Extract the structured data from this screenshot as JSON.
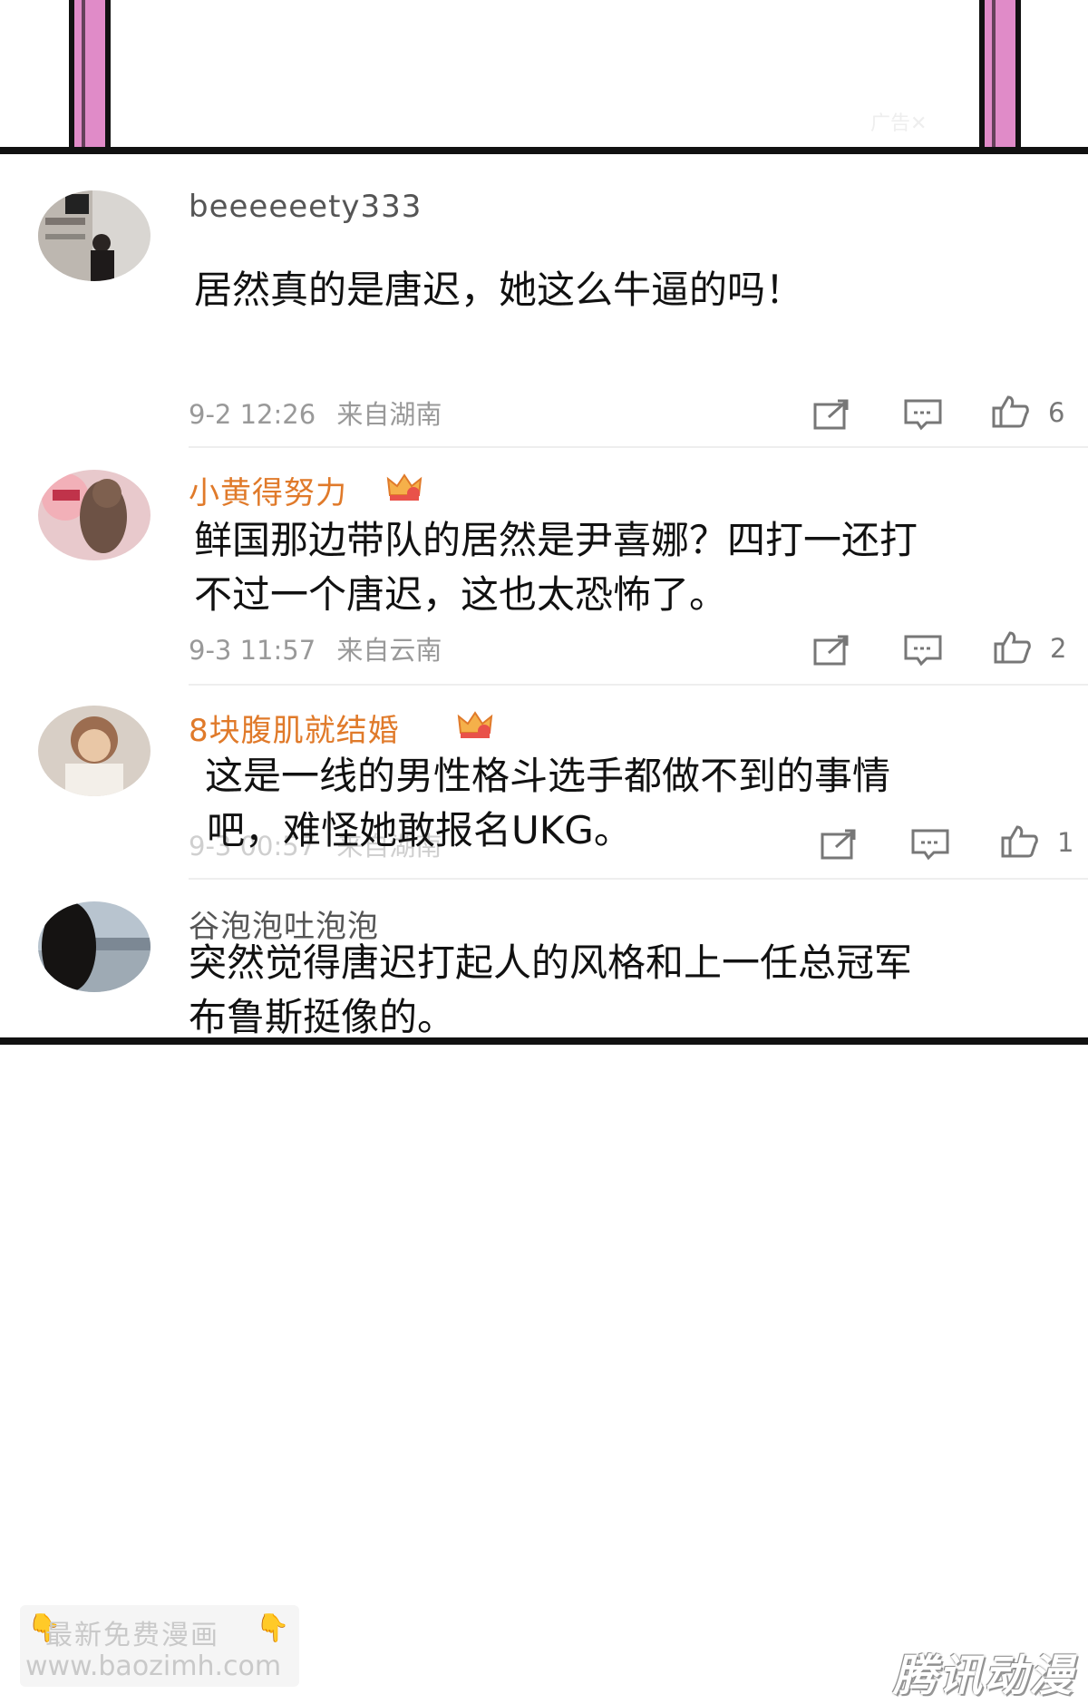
{
  "top_panel": {
    "faint_tag": "广告✕"
  },
  "comments": [
    {
      "username": "beeeeeety333",
      "text_lines": [
        "居然真的是唐迟，她这么牛逼的吗！"
      ],
      "time": "9-2 12:26",
      "source": "来自湖南",
      "likes": "6",
      "vip": false
    },
    {
      "username": "小黄得努力",
      "text_lines": [
        "鲜国那边带队的居然是尹喜娜？四打一还打",
        "不过一个唐迟，这也太恐怖了。"
      ],
      "time": "9-3 11:57",
      "source": "来自云南",
      "likes": "2",
      "vip": true
    },
    {
      "username": "8块腹肌就结婚",
      "text_lines": [
        "这是一线的男性格斗选手都做不到的事情",
        "吧，难怪她敢报名UKG。"
      ],
      "time": "9-3 00:57",
      "source": "来自湖南",
      "likes": "1",
      "vip": true
    },
    {
      "username": "谷泡泡吐泡泡",
      "text_lines": [
        "突然觉得唐迟打起人的风格和上一任总冠军",
        "布鲁斯挺像的。"
      ],
      "vip": false
    }
  ],
  "icons": {
    "forward": "share-square-icon",
    "comment": "comment-bubble-icon",
    "like": "thumbs-up-icon"
  },
  "footer": {
    "watermark_title": "最新免费漫画",
    "watermark_url": "www.baozimh.com",
    "brand": "腾讯动漫"
  },
  "colors": {
    "pillar": "#e08bc8",
    "vip_name": "#e07a2a",
    "meta": "#999999"
  }
}
